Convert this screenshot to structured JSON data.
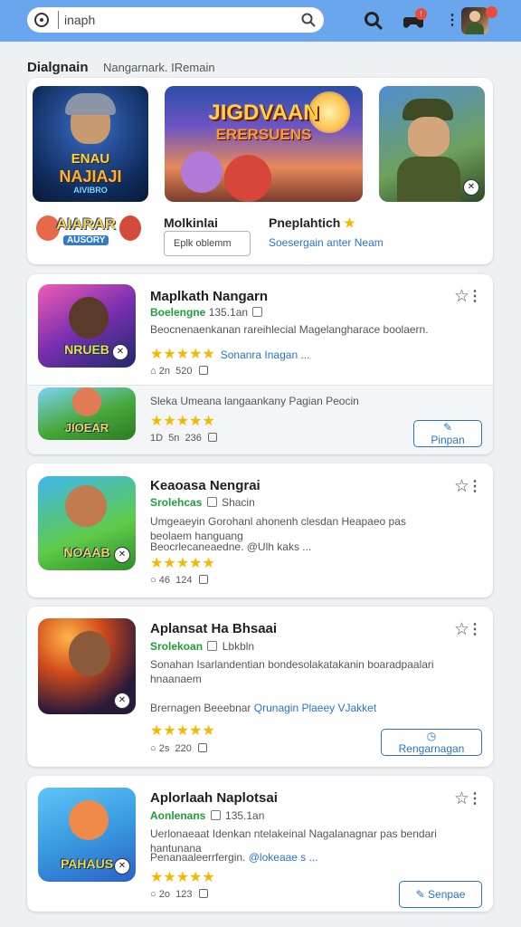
{
  "topbar": {
    "search_value": "inaph",
    "icons": [
      "history-icon",
      "search-icon",
      "game-controller-icon",
      "notifications-icon",
      "more-vert-icon"
    ],
    "accent": "#6aa6ee"
  },
  "header": {
    "tab_main": "Dialgnain",
    "tab_sub": "Nangarnark. IRemain"
  },
  "featured": {
    "art1_line1": "ENAU",
    "art1_line2": "NAJIAJI",
    "art1_line3": "AIVIBRO",
    "art2_line1": "JIGDVAAN",
    "art2_line2": "ERERSUENS",
    "art3_logo": "AIARAR",
    "art3_sub": "AUSORY",
    "col1_title": "Molkinlai",
    "col1_button": "Eplk oblemm",
    "col2_title": "Pneplahtich",
    "col2_link": "Soesergain anter Neam"
  },
  "apps": [
    {
      "title": "Maplkath Nangarn",
      "developer": "Boelengne",
      "size": "135.1an",
      "description": "Beocnenaenkanan rareihlecial Magelangharace boolaern.",
      "rating": "★★★★★",
      "rating_note": "Sonanra Inagan ...",
      "meta_a": "2n",
      "meta_b": "520",
      "thumb_label": "NRUEB"
    },
    {
      "title": "",
      "developer": "",
      "size": "",
      "description": "Sleka Umeana langaankany Pagian Peocin",
      "rating": "★★★★★",
      "rating_note": "",
      "meta_a": "1D",
      "meta_b": "5n",
      "meta_c": "236",
      "thumb_label": "JIOEAR",
      "action": "Pinpan"
    },
    {
      "title": "Keaoasa Nengrai",
      "developer": "Srolehcas",
      "size": "Shacin",
      "description": "Umgeaeyin Gorohanl ahonenh clesdan Heapaeo pas beolaem hanguang",
      "link": "Beocrlecaneaedne. @Ulh kaks ...",
      "rating": "★★★★★",
      "rating_note": "",
      "meta_a": "46",
      "meta_b": "124",
      "thumb_label": "NOAAB"
    },
    {
      "title": "Aplansat Ha Bhsaai",
      "developer": "Srolekoan",
      "size": "Lbkbln",
      "description": "Sonahan Isarlandentian bondesolakatakanin boaradpaalari hnaanaem",
      "link_grey": "Brernagen Beeebnar",
      "link": "Qrunagin Plaeey VJakket",
      "rating": "★★★★★",
      "rating_note": "",
      "meta_a": "2s",
      "meta_b": "220",
      "thumb_label": "",
      "action": "Rengarnagan"
    },
    {
      "title": "Aplorlaah Naplotsai",
      "developer": "Aonlenans",
      "size": "135.1an",
      "description": "Uerlonaeaat Idenkan ntelakeinal Nagalanagnar pas bendari hantunana",
      "link_grey": "Penanaaleerrfergin.",
      "link": "@lokeaae s ...",
      "rating": "★★★★★",
      "rating_note": "",
      "meta_a": "2o",
      "meta_b": "123",
      "thumb_label": "PAHAUS",
      "action": "Senpae"
    }
  ]
}
